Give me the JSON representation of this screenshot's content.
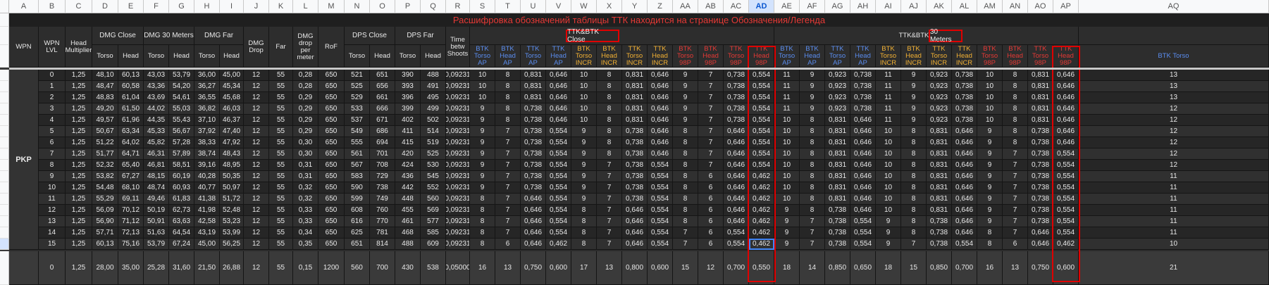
{
  "column_letters": [
    "A",
    "B",
    "C",
    "D",
    "E",
    "F",
    "G",
    "H",
    "I",
    "J",
    "K",
    "L",
    "M",
    "N",
    "O",
    "P",
    "Q",
    "R",
    "S",
    "T",
    "U",
    "V",
    "W",
    "X",
    "Y",
    "Z",
    "AA",
    "AB",
    "AC",
    "AD",
    "AE",
    "AF",
    "AG",
    "AH",
    "AI",
    "AJ",
    "AK",
    "AL",
    "AM",
    "AN",
    "AO",
    "AP",
    "AQ"
  ],
  "selected_column": "AD",
  "banner_text": "Расшифровка обозначений таблицы ТТК находится на странице Обозначения/Легенда",
  "weapon_name": "PKP",
  "headers": {
    "wpn": "WPN",
    "wpn_lvl": "WPN LVL",
    "head_mult": "Head Multiplier",
    "dmg_close": "DMG Close",
    "dmg_30": "DMG 30 Meters",
    "dmg_far": "DMG Far",
    "dmg_drop": "DMG Drop",
    "far": "Far",
    "dmg_drop_per_meter": "DMG drop per meter",
    "rof": "RoF",
    "dps_close": "DPS Close",
    "dps_far": "DPS Far",
    "time_betw": "Time betw Shoots",
    "ttk_close": "TTK&BTK Close",
    "ttk_30_prefix": "TTK&BTK",
    "ttk_30_boxed": "30 Meters",
    "torso": "Torso",
    "head": "Head"
  },
  "sub_headers": [
    "BTK Torso AP",
    "BTK Head AP",
    "TTK Torso AP",
    "TTK Head AP",
    "BTK Torso INCR",
    "BTK Head INCR",
    "TTK Torso INCR",
    "TTK Head INCR",
    "BTK Torso 98P",
    "BTK Head 98P",
    "TTK Torso 98P",
    "TTK Head 98P"
  ],
  "sub_header_colors": [
    "#5b8def",
    "#5b8def",
    "#5b8def",
    "#5b8def",
    "#f2b134",
    "#f2b134",
    "#f2b134",
    "#f2b134",
    "#e53935",
    "#e53935",
    "#e53935",
    "#e53935"
  ],
  "extra_sub_header": "BTK Torso",
  "rows": [
    [
      "0",
      "1,25",
      "48,10",
      "60,13",
      "43,03",
      "53,79",
      "36,00",
      "45,00",
      "12",
      "55",
      "0,28",
      "650",
      "521",
      "651",
      "390",
      "488",
      "0,09231",
      "10",
      "8",
      "0,831",
      "0,646",
      "10",
      "8",
      "0,831",
      "0,646",
      "9",
      "7",
      "0,738",
      "0,554",
      "11",
      "9",
      "0,923",
      "0,738",
      "11",
      "9",
      "0,923",
      "0,738",
      "10",
      "8",
      "0,831",
      "0,646",
      "13"
    ],
    [
      "1",
      "1,25",
      "48,47",
      "60,58",
      "43,36",
      "54,20",
      "36,27",
      "45,34",
      "12",
      "55",
      "0,28",
      "650",
      "525",
      "656",
      "393",
      "491",
      "0,09231",
      "10",
      "8",
      "0,831",
      "0,646",
      "10",
      "8",
      "0,831",
      "0,646",
      "9",
      "7",
      "0,738",
      "0,554",
      "11",
      "9",
      "0,923",
      "0,738",
      "11",
      "9",
      "0,923",
      "0,738",
      "10",
      "8",
      "0,831",
      "0,646",
      "13"
    ],
    [
      "2",
      "1,25",
      "48,83",
      "61,04",
      "43,69",
      "54,61",
      "36,55",
      "45,68",
      "12",
      "55",
      "0,29",
      "650",
      "529",
      "661",
      "396",
      "495",
      "0,09231",
      "10",
      "8",
      "0,831",
      "0,646",
      "10",
      "8",
      "0,831",
      "0,646",
      "9",
      "7",
      "0,738",
      "0,554",
      "11",
      "9",
      "0,923",
      "0,738",
      "11",
      "9",
      "0,923",
      "0,738",
      "10",
      "8",
      "0,831",
      "0,646",
      "13"
    ],
    [
      "3",
      "1,25",
      "49,20",
      "61,50",
      "44,02",
      "55,03",
      "36,82",
      "46,03",
      "12",
      "55",
      "0,29",
      "650",
      "533",
      "666",
      "399",
      "499",
      "0,09231",
      "9",
      "8",
      "0,738",
      "0,646",
      "10",
      "8",
      "0,831",
      "0,646",
      "9",
      "7",
      "0,738",
      "0,554",
      "11",
      "9",
      "0,923",
      "0,738",
      "11",
      "9",
      "0,923",
      "0,738",
      "10",
      "8",
      "0,831",
      "0,646",
      "12"
    ],
    [
      "4",
      "1,25",
      "49,57",
      "61,96",
      "44,35",
      "55,43",
      "37,10",
      "46,37",
      "12",
      "55",
      "0,29",
      "650",
      "537",
      "671",
      "402",
      "502",
      "0,09231",
      "9",
      "8",
      "0,738",
      "0,646",
      "10",
      "8",
      "0,831",
      "0,646",
      "9",
      "7",
      "0,738",
      "0,554",
      "10",
      "8",
      "0,831",
      "0,646",
      "11",
      "9",
      "0,923",
      "0,738",
      "10",
      "8",
      "0,831",
      "0,646",
      "12"
    ],
    [
      "5",
      "1,25",
      "50,67",
      "63,34",
      "45,33",
      "56,67",
      "37,92",
      "47,40",
      "12",
      "55",
      "0,29",
      "650",
      "549",
      "686",
      "411",
      "514",
      "0,09231",
      "9",
      "7",
      "0,738",
      "0,554",
      "9",
      "8",
      "0,738",
      "0,646",
      "8",
      "7",
      "0,646",
      "0,554",
      "10",
      "8",
      "0,831",
      "0,646",
      "10",
      "8",
      "0,831",
      "0,646",
      "9",
      "8",
      "0,738",
      "0,646",
      "12"
    ],
    [
      "6",
      "1,25",
      "51,22",
      "64,02",
      "45,82",
      "57,28",
      "38,33",
      "47,92",
      "12",
      "55",
      "0,30",
      "650",
      "555",
      "694",
      "415",
      "519",
      "0,09231",
      "9",
      "7",
      "0,738",
      "0,554",
      "9",
      "8",
      "0,738",
      "0,646",
      "8",
      "7",
      "0,646",
      "0,554",
      "10",
      "8",
      "0,831",
      "0,646",
      "10",
      "8",
      "0,831",
      "0,646",
      "9",
      "8",
      "0,738",
      "0,646",
      "12"
    ],
    [
      "7",
      "1,25",
      "51,77",
      "64,71",
      "46,31",
      "57,89",
      "38,74",
      "48,43",
      "12",
      "55",
      "0,30",
      "650",
      "561",
      "701",
      "420",
      "525",
      "0,09231",
      "9",
      "7",
      "0,738",
      "0,554",
      "9",
      "8",
      "0,738",
      "0,646",
      "8",
      "7",
      "0,646",
      "0,554",
      "10",
      "8",
      "0,831",
      "0,646",
      "10",
      "8",
      "0,831",
      "0,646",
      "9",
      "7",
      "0,738",
      "0,554",
      "12"
    ],
    [
      "8",
      "1,25",
      "52,32",
      "65,40",
      "46,81",
      "58,51",
      "39,16",
      "48,95",
      "12",
      "55",
      "0,31",
      "650",
      "567",
      "708",
      "424",
      "530",
      "0,09231",
      "9",
      "7",
      "0,738",
      "0,554",
      "9",
      "7",
      "0,738",
      "0,554",
      "8",
      "7",
      "0,646",
      "0,554",
      "10",
      "8",
      "0,831",
      "0,646",
      "10",
      "8",
      "0,831",
      "0,646",
      "9",
      "7",
      "0,738",
      "0,554",
      "12"
    ],
    [
      "9",
      "1,25",
      "53,82",
      "67,27",
      "48,15",
      "60,19",
      "40,28",
      "50,35",
      "12",
      "55",
      "0,31",
      "650",
      "583",
      "729",
      "436",
      "545",
      "0,09231",
      "9",
      "7",
      "0,738",
      "0,554",
      "9",
      "7",
      "0,738",
      "0,554",
      "8",
      "6",
      "0,646",
      "0,462",
      "10",
      "8",
      "0,831",
      "0,646",
      "10",
      "8",
      "0,831",
      "0,646",
      "9",
      "7",
      "0,738",
      "0,554",
      "11"
    ],
    [
      "10",
      "1,25",
      "54,48",
      "68,10",
      "48,74",
      "60,93",
      "40,77",
      "50,97",
      "12",
      "55",
      "0,32",
      "650",
      "590",
      "738",
      "442",
      "552",
      "0,09231",
      "9",
      "7",
      "0,738",
      "0,554",
      "9",
      "7",
      "0,738",
      "0,554",
      "8",
      "6",
      "0,646",
      "0,462",
      "10",
      "8",
      "0,831",
      "0,646",
      "10",
      "8",
      "0,831",
      "0,646",
      "9",
      "7",
      "0,738",
      "0,554",
      "11"
    ],
    [
      "11",
      "1,25",
      "55,29",
      "69,11",
      "49,46",
      "61,83",
      "41,38",
      "51,72",
      "12",
      "55",
      "0,32",
      "650",
      "599",
      "749",
      "448",
      "560",
      "0,09231",
      "8",
      "7",
      "0,646",
      "0,554",
      "9",
      "7",
      "0,738",
      "0,554",
      "8",
      "6",
      "0,646",
      "0,462",
      "10",
      "8",
      "0,831",
      "0,646",
      "10",
      "8",
      "0,831",
      "0,646",
      "9",
      "7",
      "0,738",
      "0,554",
      "11"
    ],
    [
      "12",
      "1,25",
      "56,09",
      "70,12",
      "50,19",
      "62,73",
      "41,98",
      "52,48",
      "12",
      "55",
      "0,33",
      "650",
      "608",
      "760",
      "455",
      "569",
      "0,09231",
      "8",
      "7",
      "0,646",
      "0,554",
      "8",
      "7",
      "0,646",
      "0,554",
      "8",
      "6",
      "0,646",
      "0,462",
      "9",
      "8",
      "0,738",
      "0,646",
      "10",
      "8",
      "0,831",
      "0,646",
      "9",
      "7",
      "0,738",
      "0,554",
      "11"
    ],
    [
      "13",
      "1,25",
      "56,90",
      "71,12",
      "50,91",
      "63,63",
      "42,58",
      "53,23",
      "12",
      "55",
      "0,33",
      "650",
      "616",
      "770",
      "461",
      "577",
      "0,09231",
      "8",
      "7",
      "0,646",
      "0,554",
      "8",
      "7",
      "0,646",
      "0,554",
      "8",
      "6",
      "0,646",
      "0,462",
      "9",
      "7",
      "0,738",
      "0,554",
      "9",
      "8",
      "0,738",
      "0,646",
      "9",
      "7",
      "0,738",
      "0,554",
      "11"
    ],
    [
      "14",
      "1,25",
      "57,71",
      "72,13",
      "51,63",
      "64,54",
      "43,19",
      "53,99",
      "12",
      "55",
      "0,34",
      "650",
      "625",
      "781",
      "468",
      "585",
      "0,09231",
      "8",
      "7",
      "0,646",
      "0,554",
      "8",
      "7",
      "0,646",
      "0,554",
      "7",
      "6",
      "0,554",
      "0,462",
      "9",
      "7",
      "0,738",
      "0,554",
      "9",
      "8",
      "0,738",
      "0,646",
      "8",
      "7",
      "0,646",
      "0,554",
      "11"
    ],
    [
      "15",
      "1,25",
      "60,13",
      "75,16",
      "53,79",
      "67,24",
      "45,00",
      "56,25",
      "12",
      "55",
      "0,35",
      "650",
      "651",
      "814",
      "488",
      "609",
      "0,09231",
      "8",
      "6",
      "0,646",
      "0,462",
      "8",
      "7",
      "0,646",
      "0,554",
      "7",
      "6",
      "0,554",
      "0,462",
      "9",
      "7",
      "0,738",
      "0,554",
      "9",
      "7",
      "0,738",
      "0,554",
      "8",
      "6",
      "0,646",
      "0,462",
      "10"
    ]
  ],
  "bottom_row": [
    "",
    "0",
    "1,25",
    "28,00",
    "35,00",
    "25,28",
    "31,60",
    "21,50",
    "26,88",
    "12",
    "55",
    "0,15",
    "1200",
    "560",
    "700",
    "430",
    "538",
    "0,05000",
    "16",
    "13",
    "0,750",
    "0,600",
    "17",
    "13",
    "0,800",
    "0,600",
    "15",
    "12",
    "0,700",
    "0,550",
    "18",
    "14",
    "0,850",
    "0,650",
    "18",
    "15",
    "0,850",
    "0,700",
    "16",
    "13",
    "0,750",
    "0,600",
    "21"
  ]
}
